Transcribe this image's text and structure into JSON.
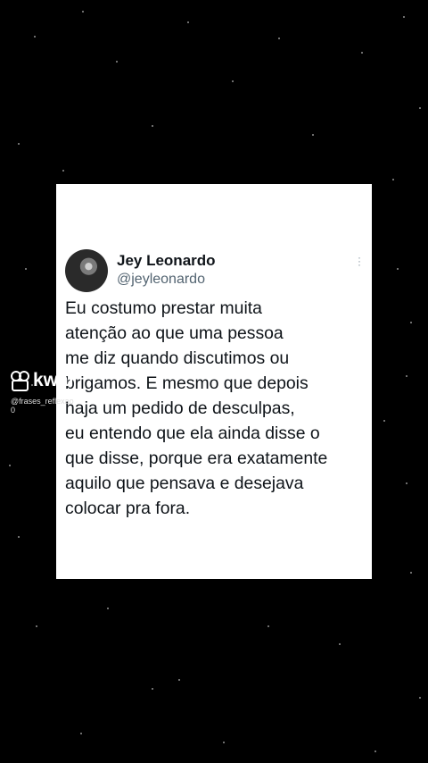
{
  "tweet": {
    "author_name": "Jey Leonardo",
    "author_handle": "@jeyleonardo",
    "text": "Eu costumo prestar muita\natenção ao que uma pessoa\nme diz quando discutimos ou\nbrigamos. E mesmo que depois\nhaja um pedido de desculpas,\neu entendo que ela ainda disse o\nque disse, porque era exatamente\naquilo que pensava e desejava\ncolocar pra fora.",
    "more_icon": "more-vertical-icon"
  },
  "watermark": {
    "app_name": "kwai",
    "user": "@frases_reflexao",
    "id": "0"
  },
  "colors": {
    "background": "#000000",
    "card": "#ffffff",
    "text": "#0f1419",
    "secondary": "#536471"
  }
}
